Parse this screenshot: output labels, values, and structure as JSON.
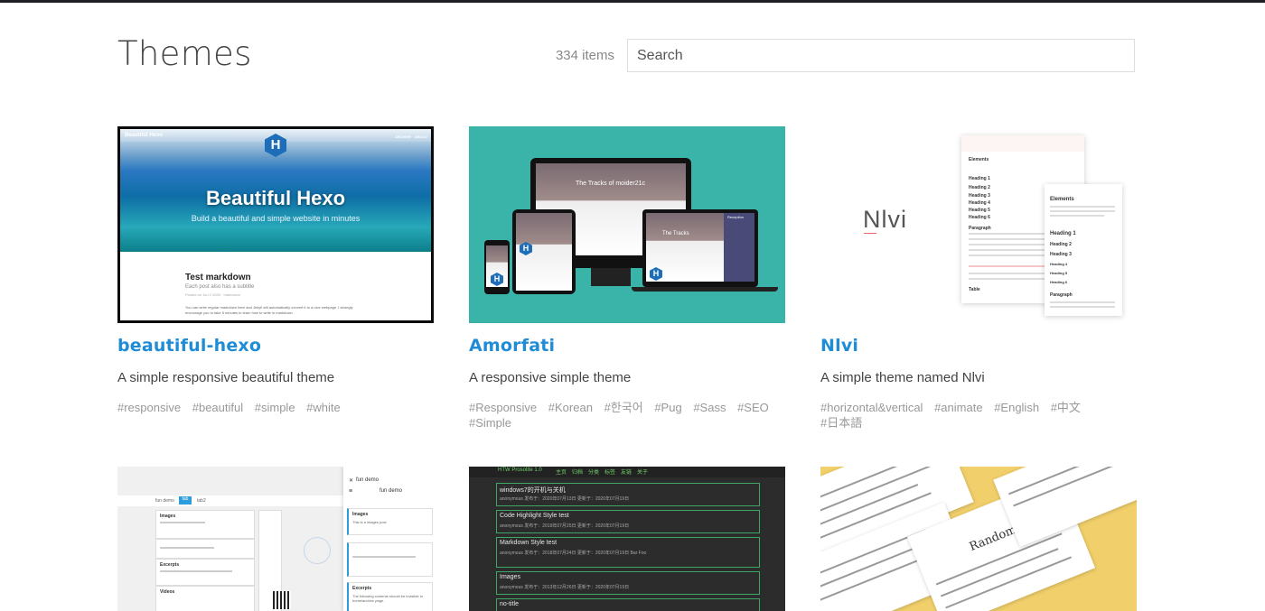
{
  "header": {
    "title": "Themes",
    "count": "334 items",
    "search_placeholder": "Search"
  },
  "cards": [
    {
      "name": "beautiful-hexo",
      "description": "A simple responsive beautiful theme",
      "tags": [
        "#responsive",
        "#beautiful",
        "#simple",
        "#white"
      ],
      "preview": {
        "nav_left": "Beautiful Hexo",
        "nav_right": [
          "ARCHIVE",
          "ABOUT"
        ],
        "logo": "H",
        "headline": "Beautiful Hexo",
        "subline": "Build a beautiful and simple website in minutes",
        "post_title": "Test markdown",
        "post_sub": "Each post also has a subtitle",
        "post_meta": "Posted on Jun 2 2020 · markdown",
        "post_body": "You can write regular markdown here and Jekyll will automatically convert it to a nice webpage. I strongly encourage you to take 5 minutes to learn how to write in markdown"
      }
    },
    {
      "name": "Amorfati",
      "description": "A responsive simple theme",
      "tags": [
        "#Responsive",
        "#Korean",
        "#한국어",
        "#Pug",
        "#Sass",
        "#SEO",
        "#Simple"
      ],
      "preview": {
        "logo": "H",
        "screen_title": "The Tracks of moider21c",
        "side_title": "Reception",
        "tablet_title": "The Tracks"
      }
    },
    {
      "name": "Nlvi",
      "description": "A simple theme named Nlvi",
      "tags": [
        "#horizontal&vertical",
        "#animate",
        "#English",
        "#中文",
        "#日本語"
      ],
      "preview": {
        "logo": "Nlvi",
        "back_title": "Elements",
        "back_items": [
          "Heading 1",
          "Heading 2",
          "Heading 3",
          "Heading 4",
          "Heading 5",
          "Heading 6",
          "Paragraph",
          "Table"
        ],
        "front_title": "Elements",
        "front_items": [
          "Heading 1",
          "Heading 2",
          "Heading 3",
          "Heading 4",
          "Heading 5",
          "Heading 6",
          "Paragraph"
        ]
      }
    },
    {
      "name": "",
      "description": "",
      "tags": [],
      "preview": {
        "tabs": [
          "fun demo",
          "tab",
          "tab2"
        ],
        "phone_title": "fun demo",
        "left_items": [
          "Images",
          "Excerpts",
          "Videos"
        ],
        "phone_items": [
          "Images",
          "Excerpts"
        ],
        "phone_texts": [
          "This is a images post",
          "The following contents should be invisible in home/archive page."
        ]
      }
    },
    {
      "name": "",
      "description": "",
      "tags": [],
      "preview": {
        "brand": "HTW Prosolite 1.0",
        "nav": [
          "主页",
          "归档",
          "分类",
          "标签",
          "友链",
          "关于"
        ],
        "posts": [
          {
            "title": "windows7的开机与关机",
            "meta": "anonymous  发布于：2020年07月13日  更新于：2020年07月19日"
          },
          {
            "title": "Code Highlight Style test",
            "meta": "anonymous  发布于：2019年07月25日  更新于：2020年07月19日"
          },
          {
            "title": "Markdown Style test",
            "meta": "anonymous  发布于：2018年07月24日  更新于：2020年07月19日  Bar  Foo"
          },
          {
            "title": "Images",
            "meta": "anonymous  发布于：2013年12月26日  更新于：2020年07月19日"
          },
          {
            "title": "no-title",
            "meta": ""
          }
        ]
      }
    },
    {
      "name": "",
      "description": "",
      "tags": [],
      "preview": {
        "logo": "RandomYang"
      }
    }
  ]
}
